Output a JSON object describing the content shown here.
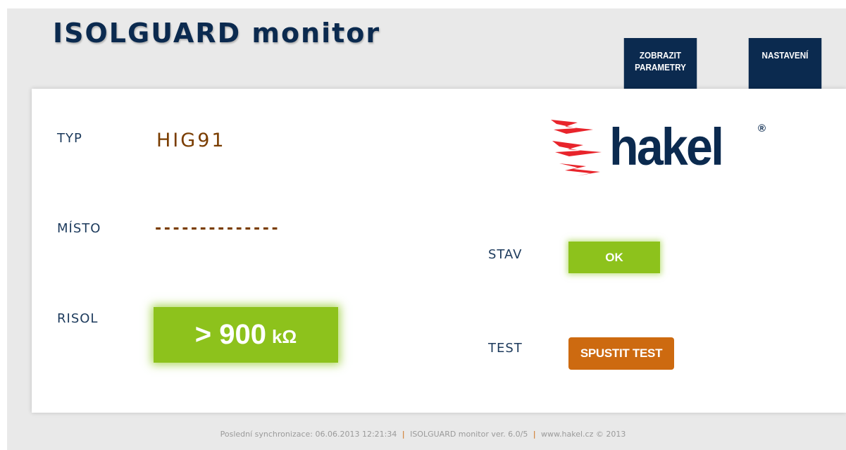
{
  "app": {
    "title": "ISOLGUARD monitor"
  },
  "nav": {
    "params_label": "ZOBRAZIT\nPARAMETRY",
    "settings_label": "NASTAVENÍ"
  },
  "fields": {
    "type_label": "TYP",
    "type_value": "HIG91",
    "place_label": "MÍSTO",
    "place_value": "--------------",
    "risol_label": "RISOL",
    "risol_value": "> 900",
    "risol_unit": "kΩ",
    "status_label": "STAV",
    "status_value": "OK",
    "test_label": "TEST",
    "test_button": "SPUSTIT TEST"
  },
  "logo": {
    "text": "hakel",
    "registered": "®"
  },
  "footer": {
    "sync": "Poslední synchronizace: 06.06.2013 12:21:34",
    "sep1": "|",
    "version": "ISOLGUARD monitor ver. 6.0/5",
    "sep2": "|",
    "site": "www.hakel.cz © 2013"
  },
  "colors": {
    "navy": "#0b2a4f",
    "green": "#8dc21c",
    "orange": "#cd6a10",
    "brown": "#7a3d00",
    "logo_red": "#e8242b"
  }
}
